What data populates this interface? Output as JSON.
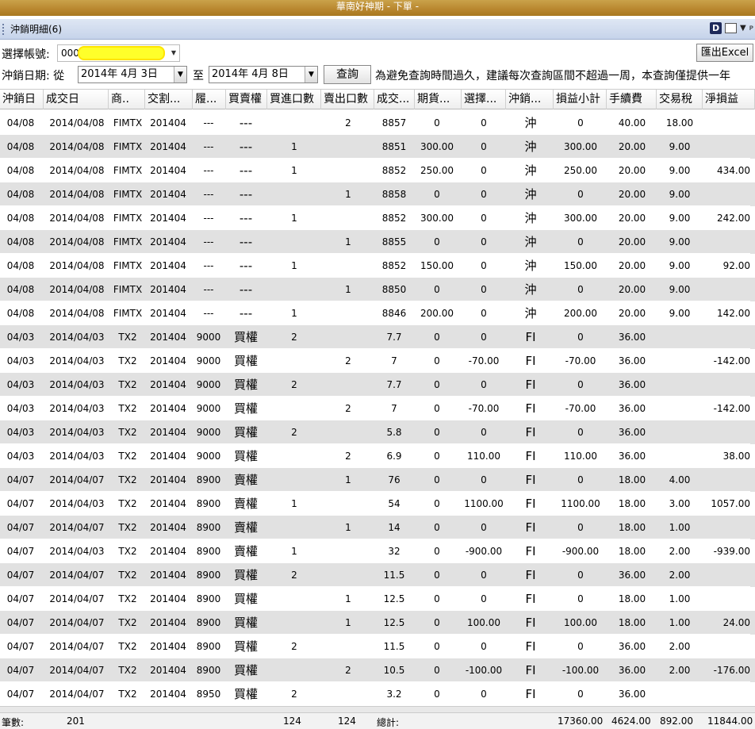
{
  "window": {
    "title": "華南好神期 - 下單 -"
  },
  "panel": {
    "title": "沖銷明細(6)",
    "pin_glyph": "ᴘ"
  },
  "toolbar": {
    "account_label": "選擇帳號:",
    "account_value": "000",
    "export_label": "匯出Excel",
    "date_label": "沖銷日期: 從",
    "date_from": "2014年  4月  3日",
    "date_to_label": "至",
    "date_to": "2014年  4月  8日",
    "query_label": "查詢",
    "note": "為避免查詢時間過久，建議每次查詢區間不超過一周，本查詢僅提供一年"
  },
  "columns": [
    "沖銷日",
    "成交日",
    "商..",
    "交割...",
    "履...",
    "買賣權",
    "買進口數",
    "賣出口數",
    "成交...",
    "期貨...",
    "選擇...",
    "沖銷...",
    "損益小計",
    "手續費",
    "交易稅",
    "淨損益"
  ],
  "rows": [
    [
      "04/08",
      "2014/04/08",
      "FIMTX",
      "201404",
      "---",
      "---",
      "",
      "2",
      "8857",
      "0",
      "0",
      "沖",
      "0",
      "40.00",
      "18.00",
      ""
    ],
    [
      "04/08",
      "2014/04/08",
      "FIMTX",
      "201404",
      "---",
      "---",
      "1",
      "",
      "8851",
      "300.00",
      "0",
      "沖",
      "300.00",
      "20.00",
      "9.00",
      ""
    ],
    [
      "04/08",
      "2014/04/08",
      "FIMTX",
      "201404",
      "---",
      "---",
      "1",
      "",
      "8852",
      "250.00",
      "0",
      "沖",
      "250.00",
      "20.00",
      "9.00",
      "434.00"
    ],
    [
      "04/08",
      "2014/04/08",
      "FIMTX",
      "201404",
      "---",
      "---",
      "",
      "1",
      "8858",
      "0",
      "0",
      "沖",
      "0",
      "20.00",
      "9.00",
      ""
    ],
    [
      "04/08",
      "2014/04/08",
      "FIMTX",
      "201404",
      "---",
      "---",
      "1",
      "",
      "8852",
      "300.00",
      "0",
      "沖",
      "300.00",
      "20.00",
      "9.00",
      "242.00"
    ],
    [
      "04/08",
      "2014/04/08",
      "FIMTX",
      "201404",
      "---",
      "---",
      "",
      "1",
      "8855",
      "0",
      "0",
      "沖",
      "0",
      "20.00",
      "9.00",
      ""
    ],
    [
      "04/08",
      "2014/04/08",
      "FIMTX",
      "201404",
      "---",
      "---",
      "1",
      "",
      "8852",
      "150.00",
      "0",
      "沖",
      "150.00",
      "20.00",
      "9.00",
      "92.00"
    ],
    [
      "04/08",
      "2014/04/08",
      "FIMTX",
      "201404",
      "---",
      "---",
      "",
      "1",
      "8850",
      "0",
      "0",
      "沖",
      "0",
      "20.00",
      "9.00",
      ""
    ],
    [
      "04/08",
      "2014/04/08",
      "FIMTX",
      "201404",
      "---",
      "---",
      "1",
      "",
      "8846",
      "200.00",
      "0",
      "沖",
      "200.00",
      "20.00",
      "9.00",
      "142.00"
    ],
    [
      "04/03",
      "2014/04/03",
      "TX2",
      "201404",
      "9000",
      "買權",
      "2",
      "",
      "7.7",
      "0",
      "0",
      "FI",
      "0",
      "36.00",
      "",
      ""
    ],
    [
      "04/03",
      "2014/04/03",
      "TX2",
      "201404",
      "9000",
      "買權",
      "",
      "2",
      "7",
      "0",
      "-70.00",
      "FI",
      "-70.00",
      "36.00",
      "",
      "-142.00"
    ],
    [
      "04/03",
      "2014/04/03",
      "TX2",
      "201404",
      "9000",
      "買權",
      "2",
      "",
      "7.7",
      "0",
      "0",
      "FI",
      "0",
      "36.00",
      "",
      ""
    ],
    [
      "04/03",
      "2014/04/03",
      "TX2",
      "201404",
      "9000",
      "買權",
      "",
      "2",
      "7",
      "0",
      "-70.00",
      "FI",
      "-70.00",
      "36.00",
      "",
      "-142.00"
    ],
    [
      "04/03",
      "2014/04/03",
      "TX2",
      "201404",
      "9000",
      "買權",
      "2",
      "",
      "5.8",
      "0",
      "0",
      "FI",
      "0",
      "36.00",
      "",
      ""
    ],
    [
      "04/03",
      "2014/04/03",
      "TX2",
      "201404",
      "9000",
      "買權",
      "",
      "2",
      "6.9",
      "0",
      "110.00",
      "FI",
      "110.00",
      "36.00",
      "",
      "38.00"
    ],
    [
      "04/07",
      "2014/04/07",
      "TX2",
      "201404",
      "8900",
      "賣權",
      "",
      "1",
      "76",
      "0",
      "0",
      "FI",
      "0",
      "18.00",
      "4.00",
      ""
    ],
    [
      "04/07",
      "2014/04/03",
      "TX2",
      "201404",
      "8900",
      "賣權",
      "1",
      "",
      "54",
      "0",
      "1100.00",
      "FI",
      "1100.00",
      "18.00",
      "3.00",
      "1057.00"
    ],
    [
      "04/07",
      "2014/04/07",
      "TX2",
      "201404",
      "8900",
      "賣權",
      "",
      "1",
      "14",
      "0",
      "0",
      "FI",
      "0",
      "18.00",
      "1.00",
      ""
    ],
    [
      "04/07",
      "2014/04/03",
      "TX2",
      "201404",
      "8900",
      "賣權",
      "1",
      "",
      "32",
      "0",
      "-900.00",
      "FI",
      "-900.00",
      "18.00",
      "2.00",
      "-939.00"
    ],
    [
      "04/07",
      "2014/04/07",
      "TX2",
      "201404",
      "8900",
      "買權",
      "2",
      "",
      "11.5",
      "0",
      "0",
      "FI",
      "0",
      "36.00",
      "2.00",
      ""
    ],
    [
      "04/07",
      "2014/04/07",
      "TX2",
      "201404",
      "8900",
      "買權",
      "",
      "1",
      "12.5",
      "0",
      "0",
      "FI",
      "0",
      "18.00",
      "1.00",
      ""
    ],
    [
      "04/07",
      "2014/04/07",
      "TX2",
      "201404",
      "8900",
      "買權",
      "",
      "1",
      "12.5",
      "0",
      "100.00",
      "FI",
      "100.00",
      "18.00",
      "1.00",
      "24.00"
    ],
    [
      "04/07",
      "2014/04/07",
      "TX2",
      "201404",
      "8900",
      "買權",
      "2",
      "",
      "11.5",
      "0",
      "0",
      "FI",
      "0",
      "36.00",
      "2.00",
      ""
    ],
    [
      "04/07",
      "2014/04/07",
      "TX2",
      "201404",
      "8900",
      "買權",
      "",
      "2",
      "10.5",
      "0",
      "-100.00",
      "FI",
      "-100.00",
      "36.00",
      "2.00",
      "-176.00"
    ],
    [
      "04/07",
      "2014/04/07",
      "TX2",
      "201404",
      "8950",
      "買權",
      "2",
      "",
      "3.2",
      "0",
      "0",
      "FI",
      "0",
      "36.00",
      "",
      ""
    ]
  ],
  "footer": {
    "count_label": "筆數:",
    "count": "201",
    "buy_total": "124",
    "sell_total": "124",
    "total_label": "總計:",
    "pl_total": "17360.00",
    "fee_total": "4624.00",
    "tax_total": "892.00",
    "net_total": "11844.00"
  }
}
